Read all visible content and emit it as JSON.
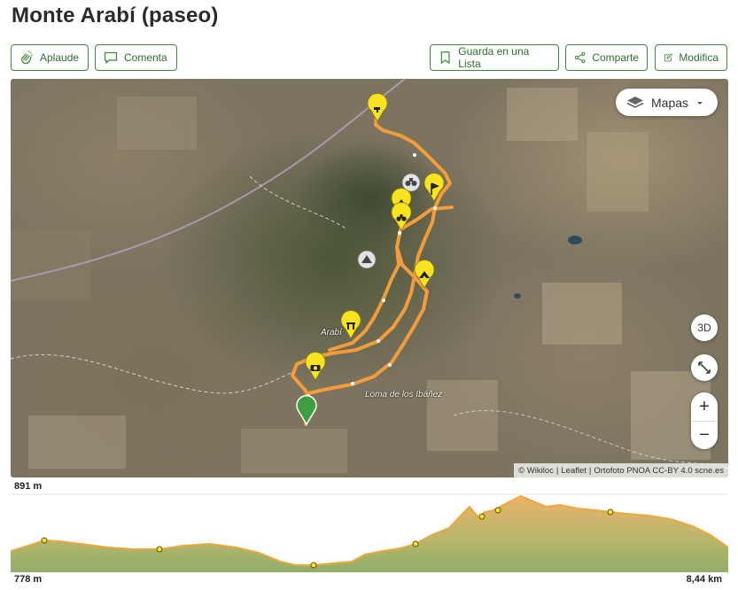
{
  "title": "Monte Arabí (paseo)",
  "actions": {
    "aplaude": "Aplaude",
    "comenta": "Comenta",
    "guarda": "Guarda en una Lista",
    "comparte": "Comparte",
    "modifica": "Modifica"
  },
  "map": {
    "layers_label": "Mapas",
    "btn_3d": "3D",
    "zoom_in": "+",
    "zoom_out": "−",
    "attribution": {
      "wikiloc": "© Wikiloc",
      "sep1": "|",
      "leaflet": "Leaflet",
      "sep2": "|",
      "ortofoto": "Ortofoto PNOA CC-BY 4.0 scne.es"
    },
    "labels": {
      "arabi": "Arabí",
      "loma": "Loma de los Ibáñez"
    },
    "waypoint_icons": [
      "water-icon",
      "flag-icon",
      "binoculars-icon",
      "cave-icon",
      "binoculars-icon",
      "cave-icon",
      "monument-icon",
      "camera-icon",
      "start-pin-icon",
      "summit-icon"
    ],
    "route_color": "#f39c3c"
  },
  "elevation": {
    "max_label": "891 m",
    "min_label": "778 m",
    "distance_label": "8,44 km",
    "fill_color": "#a7b96b"
  }
}
